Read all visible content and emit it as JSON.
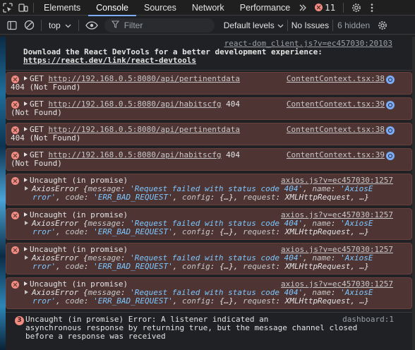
{
  "tabbar": {
    "tabs": [
      "Elements",
      "Console",
      "Sources",
      "Network",
      "Performance"
    ],
    "active_tab": "Console",
    "error_count": "11"
  },
  "toolbar": {
    "context": "top",
    "filter_placeholder": "Filter",
    "levels": "Default levels",
    "issues": "No Issues",
    "hidden": "6 hidden"
  },
  "info": {
    "source": "react-dom_client.js?v=ec457030:20103",
    "message": "Download the React DevTools for a better development experience:",
    "url": "https://react.dev/link/react-devtools"
  },
  "network_errors": [
    {
      "method": "GET",
      "url": "http://192.168.0.5:8080/api/pertinentdata",
      "status_line1": "",
      "status_line2": "404 (Not Found)",
      "source": "ContentContext.tsx:38"
    },
    {
      "method": "GET",
      "url": "http://192.168.0.5:8080/api/habitscfg",
      "status_line1": "404",
      "status_line2": "(Not Found)",
      "source": "ContentContext.tsx:39"
    },
    {
      "method": "GET",
      "url": "http://192.168.0.5:8080/api/pertinentdata",
      "status_line1": "",
      "status_line2": "404 (Not Found)",
      "source": "ContentContext.tsx:38"
    },
    {
      "method": "GET",
      "url": "http://192.168.0.5:8080/api/habitscfg",
      "status_line1": "404",
      "status_line2": "(Not Found)",
      "source": "ContentContext.tsx:39"
    }
  ],
  "uncaught_errors": [
    {
      "title": "Uncaught (in promise)",
      "source": "axios.js?v=ec457030:1257",
      "name": "AxiosError",
      "k_message": "message",
      "v_message": "'Request failed with status code 404'",
      "k_name": "name",
      "v_name_a": "'AxiosE",
      "v_name_b": "rror'",
      "k_code": "code",
      "v_code": "'ERR_BAD_REQUEST'",
      "k_config": "config",
      "v_config": "{…}",
      "k_request": "request",
      "v_request": "XMLHttpRequest, …}"
    },
    {
      "title": "Uncaught (in promise)",
      "source": "axios.js?v=ec457030:1257",
      "name": "AxiosError",
      "k_message": "message",
      "v_message": "'Request failed with status code 404'",
      "k_name": "name",
      "v_name_a": "'AxiosE",
      "v_name_b": "rror'",
      "k_code": "code",
      "v_code": "'ERR_BAD_REQUEST'",
      "k_config": "config",
      "v_config": "{…}",
      "k_request": "request",
      "v_request": "XMLHttpRequest, …}"
    },
    {
      "title": "Uncaught (in promise)",
      "source": "axios.js?v=ec457030:1257",
      "name": "AxiosError",
      "k_message": "message",
      "v_message": "'Request failed with status code 404'",
      "k_name": "name",
      "v_name_a": "'AxiosE",
      "v_name_b": "rror'",
      "k_code": "code",
      "v_code": "'ERR_BAD_REQUEST'",
      "k_config": "config",
      "v_config": "{…}",
      "k_request": "request",
      "v_request": "XMLHttpRequest, …}"
    },
    {
      "title": "Uncaught (in promise)",
      "source": "axios.js?v=ec457030:1257",
      "name": "AxiosError",
      "k_message": "message",
      "v_message": "'Request failed with status code 404'",
      "k_name": "name",
      "v_name_a": "'AxiosE",
      "v_name_b": "rror'",
      "k_code": "code",
      "v_code": "'ERR_BAD_REQUEST'",
      "k_config": "config",
      "v_config": "{…}",
      "k_request": "request",
      "v_request": "XMLHttpRequest, …}"
    }
  ],
  "last_error": {
    "count": "3",
    "line1": "Uncaught (in promise) Error: A listener indicated an",
    "line2": "asynchronous response by returning true, but the message channel closed",
    "line3": "before a response was received",
    "source": "dashboard:1"
  },
  "colors": {
    "error_bg": "#4e3534",
    "accent": "#7cacf8",
    "error_icon": "#f28b82"
  }
}
